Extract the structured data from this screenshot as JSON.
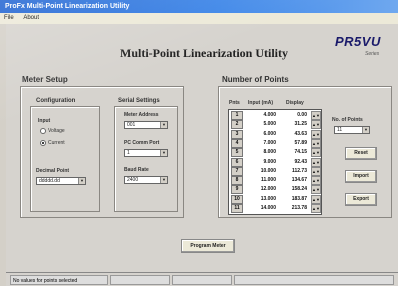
{
  "window": {
    "title": "ProFx Multi-Point Linearization Utility",
    "menu": [
      "File",
      "About"
    ]
  },
  "app": {
    "title": "Multi-Point Linearization Utility",
    "logo": "PR5VU",
    "logo_sub": "Series"
  },
  "meter_setup": {
    "title": "Meter Setup",
    "configuration": {
      "title": "Configuration",
      "input_label": "Input",
      "options": [
        "Voltage",
        "Current"
      ],
      "selected": "Current",
      "decimal_label": "Decimal Point",
      "decimal_value": "ddddd.dd"
    },
    "serial": {
      "title": "Serial Settings",
      "address_label": "Meter Address",
      "address_value": "001",
      "port_label": "PC Comm Port",
      "port_value": "1",
      "baud_label": "Baud Rate",
      "baud_value": "2400"
    }
  },
  "points": {
    "title": "Number of Points",
    "headers": [
      "Pnts",
      "Input (mA)",
      "Display"
    ],
    "rows": [
      {
        "n": "1",
        "input": "4.000",
        "display": "0.00"
      },
      {
        "n": "2",
        "input": "5.000",
        "display": "31.25"
      },
      {
        "n": "3",
        "input": "6.000",
        "display": "43.63"
      },
      {
        "n": "4",
        "input": "7.000",
        "display": "57.89"
      },
      {
        "n": "5",
        "input": "8.000",
        "display": "74.15"
      },
      {
        "n": "6",
        "input": "9.000",
        "display": "92.43"
      },
      {
        "n": "7",
        "input": "10.000",
        "display": "112.73"
      },
      {
        "n": "8",
        "input": "11.000",
        "display": "134.67"
      },
      {
        "n": "9",
        "input": "12.000",
        "display": "158.24"
      },
      {
        "n": "10",
        "input": "13.000",
        "display": "183.87"
      },
      {
        "n": "11",
        "input": "14.000",
        "display": "213.78"
      }
    ],
    "no_points_label": "No. of Points",
    "no_points_value": "11",
    "buttons": {
      "reset": "Reset",
      "import": "Import",
      "export": "Export"
    }
  },
  "program_button": "Program Meter",
  "status": {
    "message": "No values for points selected",
    "cells": [
      "",
      "",
      ""
    ]
  }
}
